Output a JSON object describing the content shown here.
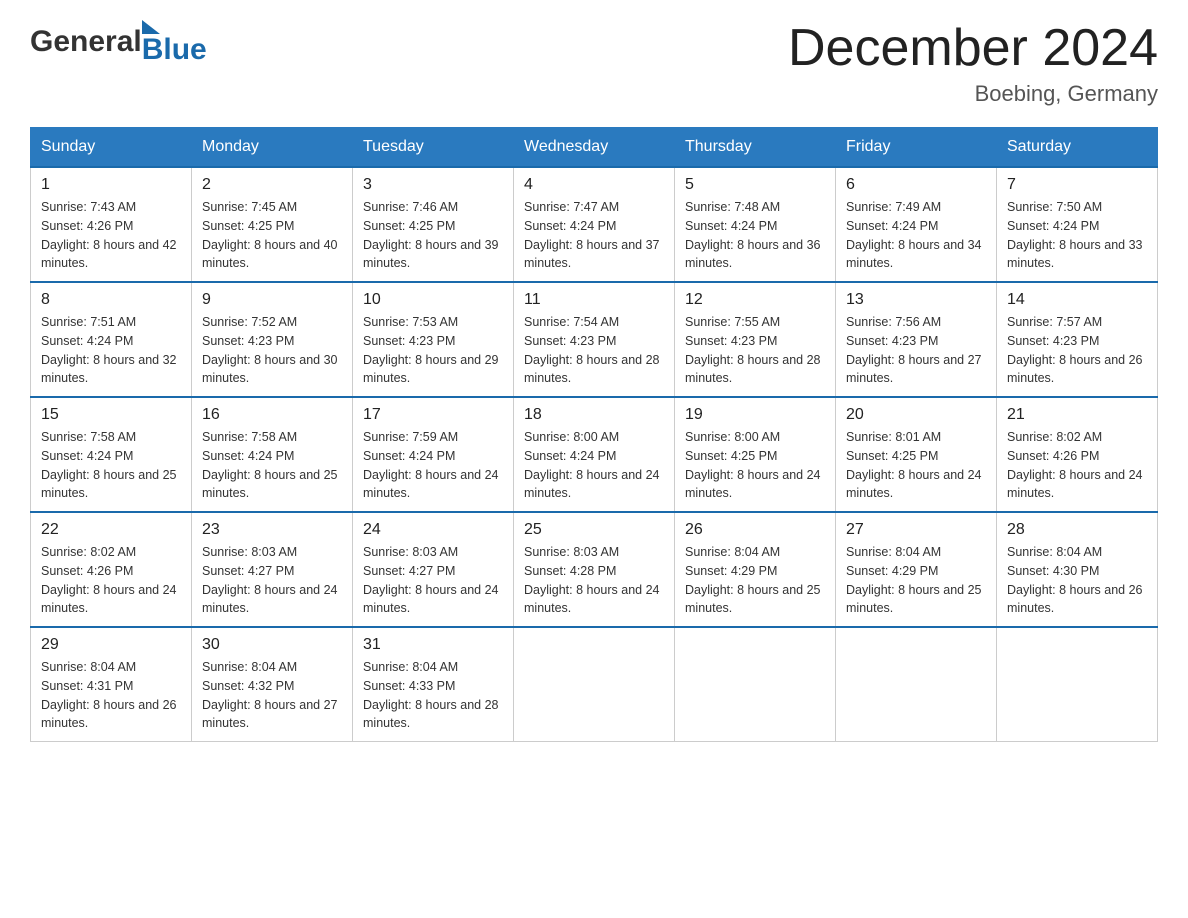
{
  "logo": {
    "part1": "General",
    "part2": "Blue"
  },
  "title": {
    "month_year": "December 2024",
    "location": "Boebing, Germany"
  },
  "days_of_week": [
    "Sunday",
    "Monday",
    "Tuesday",
    "Wednesday",
    "Thursday",
    "Friday",
    "Saturday"
  ],
  "weeks": [
    [
      {
        "day": "1",
        "sunrise": "7:43 AM",
        "sunset": "4:26 PM",
        "daylight": "8 hours and 42 minutes."
      },
      {
        "day": "2",
        "sunrise": "7:45 AM",
        "sunset": "4:25 PM",
        "daylight": "8 hours and 40 minutes."
      },
      {
        "day": "3",
        "sunrise": "7:46 AM",
        "sunset": "4:25 PM",
        "daylight": "8 hours and 39 minutes."
      },
      {
        "day": "4",
        "sunrise": "7:47 AM",
        "sunset": "4:24 PM",
        "daylight": "8 hours and 37 minutes."
      },
      {
        "day": "5",
        "sunrise": "7:48 AM",
        "sunset": "4:24 PM",
        "daylight": "8 hours and 36 minutes."
      },
      {
        "day": "6",
        "sunrise": "7:49 AM",
        "sunset": "4:24 PM",
        "daylight": "8 hours and 34 minutes."
      },
      {
        "day": "7",
        "sunrise": "7:50 AM",
        "sunset": "4:24 PM",
        "daylight": "8 hours and 33 minutes."
      }
    ],
    [
      {
        "day": "8",
        "sunrise": "7:51 AM",
        "sunset": "4:24 PM",
        "daylight": "8 hours and 32 minutes."
      },
      {
        "day": "9",
        "sunrise": "7:52 AM",
        "sunset": "4:23 PM",
        "daylight": "8 hours and 30 minutes."
      },
      {
        "day": "10",
        "sunrise": "7:53 AM",
        "sunset": "4:23 PM",
        "daylight": "8 hours and 29 minutes."
      },
      {
        "day": "11",
        "sunrise": "7:54 AM",
        "sunset": "4:23 PM",
        "daylight": "8 hours and 28 minutes."
      },
      {
        "day": "12",
        "sunrise": "7:55 AM",
        "sunset": "4:23 PM",
        "daylight": "8 hours and 28 minutes."
      },
      {
        "day": "13",
        "sunrise": "7:56 AM",
        "sunset": "4:23 PM",
        "daylight": "8 hours and 27 minutes."
      },
      {
        "day": "14",
        "sunrise": "7:57 AM",
        "sunset": "4:23 PM",
        "daylight": "8 hours and 26 minutes."
      }
    ],
    [
      {
        "day": "15",
        "sunrise": "7:58 AM",
        "sunset": "4:24 PM",
        "daylight": "8 hours and 25 minutes."
      },
      {
        "day": "16",
        "sunrise": "7:58 AM",
        "sunset": "4:24 PM",
        "daylight": "8 hours and 25 minutes."
      },
      {
        "day": "17",
        "sunrise": "7:59 AM",
        "sunset": "4:24 PM",
        "daylight": "8 hours and 24 minutes."
      },
      {
        "day": "18",
        "sunrise": "8:00 AM",
        "sunset": "4:24 PM",
        "daylight": "8 hours and 24 minutes."
      },
      {
        "day": "19",
        "sunrise": "8:00 AM",
        "sunset": "4:25 PM",
        "daylight": "8 hours and 24 minutes."
      },
      {
        "day": "20",
        "sunrise": "8:01 AM",
        "sunset": "4:25 PM",
        "daylight": "8 hours and 24 minutes."
      },
      {
        "day": "21",
        "sunrise": "8:02 AM",
        "sunset": "4:26 PM",
        "daylight": "8 hours and 24 minutes."
      }
    ],
    [
      {
        "day": "22",
        "sunrise": "8:02 AM",
        "sunset": "4:26 PM",
        "daylight": "8 hours and 24 minutes."
      },
      {
        "day": "23",
        "sunrise": "8:03 AM",
        "sunset": "4:27 PM",
        "daylight": "8 hours and 24 minutes."
      },
      {
        "day": "24",
        "sunrise": "8:03 AM",
        "sunset": "4:27 PM",
        "daylight": "8 hours and 24 minutes."
      },
      {
        "day": "25",
        "sunrise": "8:03 AM",
        "sunset": "4:28 PM",
        "daylight": "8 hours and 24 minutes."
      },
      {
        "day": "26",
        "sunrise": "8:04 AM",
        "sunset": "4:29 PM",
        "daylight": "8 hours and 25 minutes."
      },
      {
        "day": "27",
        "sunrise": "8:04 AM",
        "sunset": "4:29 PM",
        "daylight": "8 hours and 25 minutes."
      },
      {
        "day": "28",
        "sunrise": "8:04 AM",
        "sunset": "4:30 PM",
        "daylight": "8 hours and 26 minutes."
      }
    ],
    [
      {
        "day": "29",
        "sunrise": "8:04 AM",
        "sunset": "4:31 PM",
        "daylight": "8 hours and 26 minutes."
      },
      {
        "day": "30",
        "sunrise": "8:04 AM",
        "sunset": "4:32 PM",
        "daylight": "8 hours and 27 minutes."
      },
      {
        "day": "31",
        "sunrise": "8:04 AM",
        "sunset": "4:33 PM",
        "daylight": "8 hours and 28 minutes."
      },
      null,
      null,
      null,
      null
    ]
  ],
  "labels": {
    "sunrise_prefix": "Sunrise: ",
    "sunset_prefix": "Sunset: ",
    "daylight_prefix": "Daylight: "
  }
}
